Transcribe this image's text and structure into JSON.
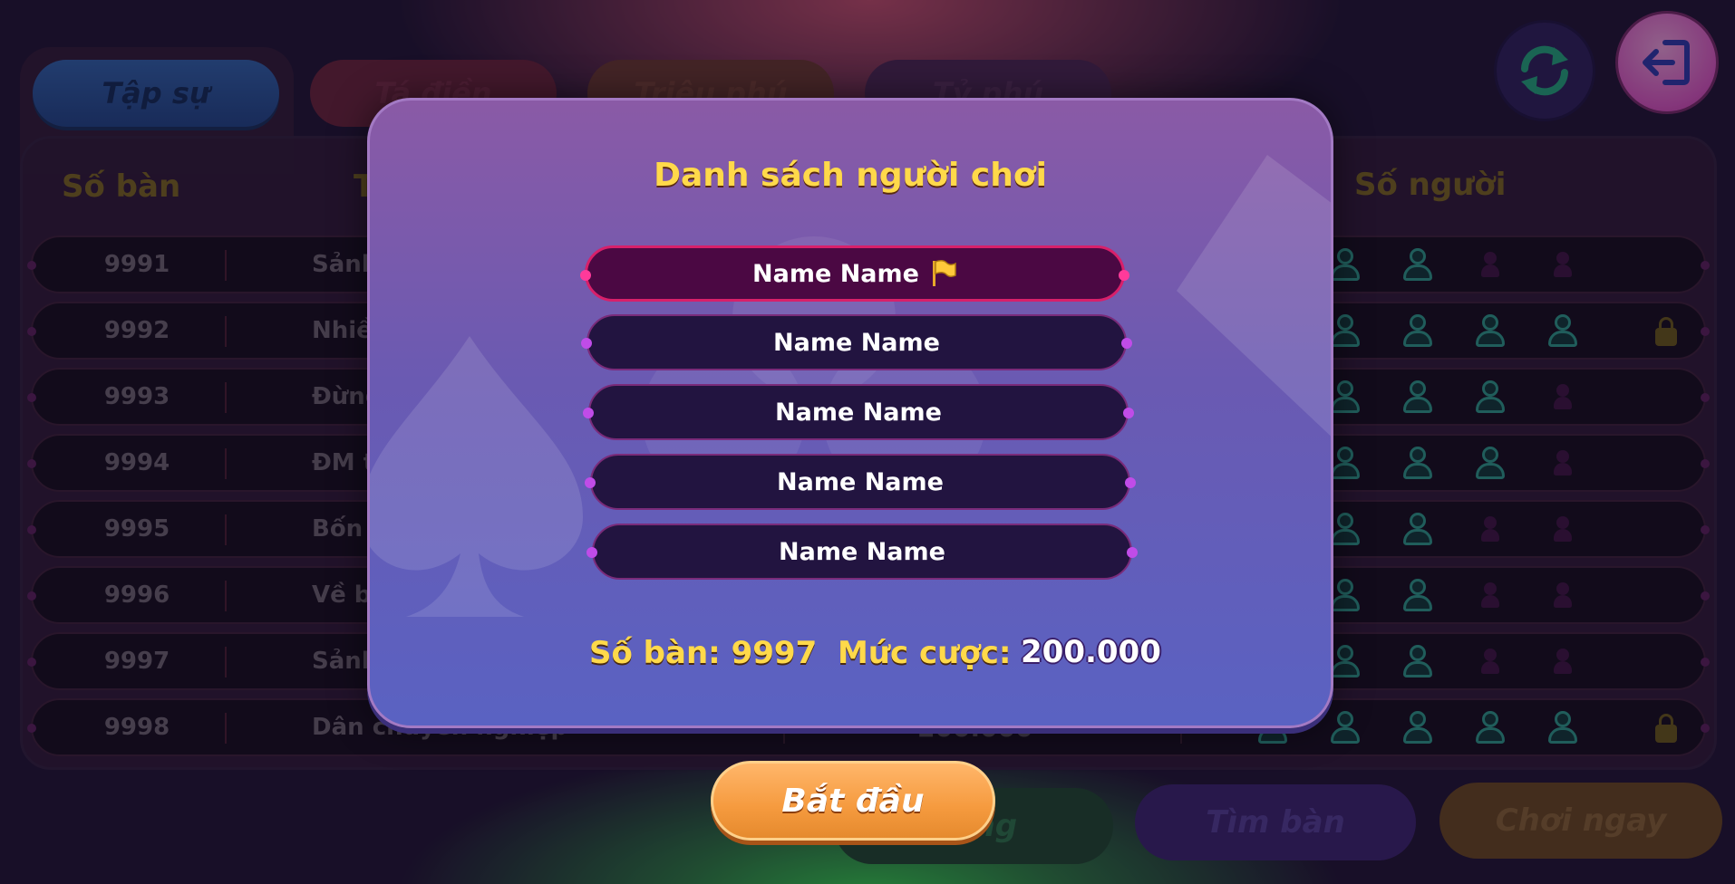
{
  "lobby": {
    "tabs": [
      "Tập sự",
      "Tá điền",
      "Triệu phú",
      "Tỷ phú"
    ],
    "columns": {
      "table_no": "Số bàn",
      "name": "T",
      "players": "Số người"
    },
    "rows": [
      {
        "no": "9991",
        "name": "Sảnh",
        "seats": [
          1,
          1,
          0,
          0
        ],
        "locked": false
      },
      {
        "no": "9992",
        "name": "Nhiề",
        "seats": [
          1,
          1,
          1,
          1
        ],
        "locked": true
      },
      {
        "no": "9993",
        "name": "Đừng",
        "seats": [
          1,
          1,
          1,
          0
        ],
        "locked": false
      },
      {
        "no": "9994",
        "name": "ĐM t",
        "seats": [
          1,
          1,
          1,
          0
        ],
        "locked": false
      },
      {
        "no": "9995",
        "name": "Bốn c",
        "seats": [
          1,
          1,
          0,
          0
        ],
        "locked": false
      },
      {
        "no": "9996",
        "name": "Về bà",
        "seats": [
          1,
          1,
          0,
          0
        ],
        "locked": false
      },
      {
        "no": "9997",
        "name": "Sảnh",
        "seats": [
          1,
          1,
          0,
          0
        ],
        "locked": false
      },
      {
        "no": "9998",
        "name": "Dân chuyên nghiệp",
        "bet": "200.000",
        "seats": [
          1,
          1,
          1,
          1,
          1
        ],
        "locked": true
      }
    ],
    "buttons": {
      "phong": "hòng",
      "find_table": "Tìm bàn",
      "play_now": "Chơi ngay"
    }
  },
  "modal": {
    "title": "Danh sách người chơi",
    "players": [
      {
        "name": "Name Name",
        "host": true
      },
      {
        "name": "Name Name",
        "host": false
      },
      {
        "name": "Name Name",
        "host": false
      },
      {
        "name": "Name Name",
        "host": false
      },
      {
        "name": "Name Name",
        "host": false
      }
    ],
    "table_label": "Số bàn:",
    "table_no": "9997",
    "bet_label": "Mức cược:",
    "bet_value": "200.000",
    "start_label": "Bắt đầu"
  },
  "icons": {
    "refresh": "refresh-icon",
    "exit": "exit-icon",
    "host_flag": "flag-icon",
    "seat": "person-icon",
    "lock": "lock-icon"
  },
  "colors": {
    "title_yellow": "#ffd94a",
    "host_border": "#d8206a",
    "start_orange": "#f59a3e",
    "seat_teal": "#2aa08c"
  }
}
